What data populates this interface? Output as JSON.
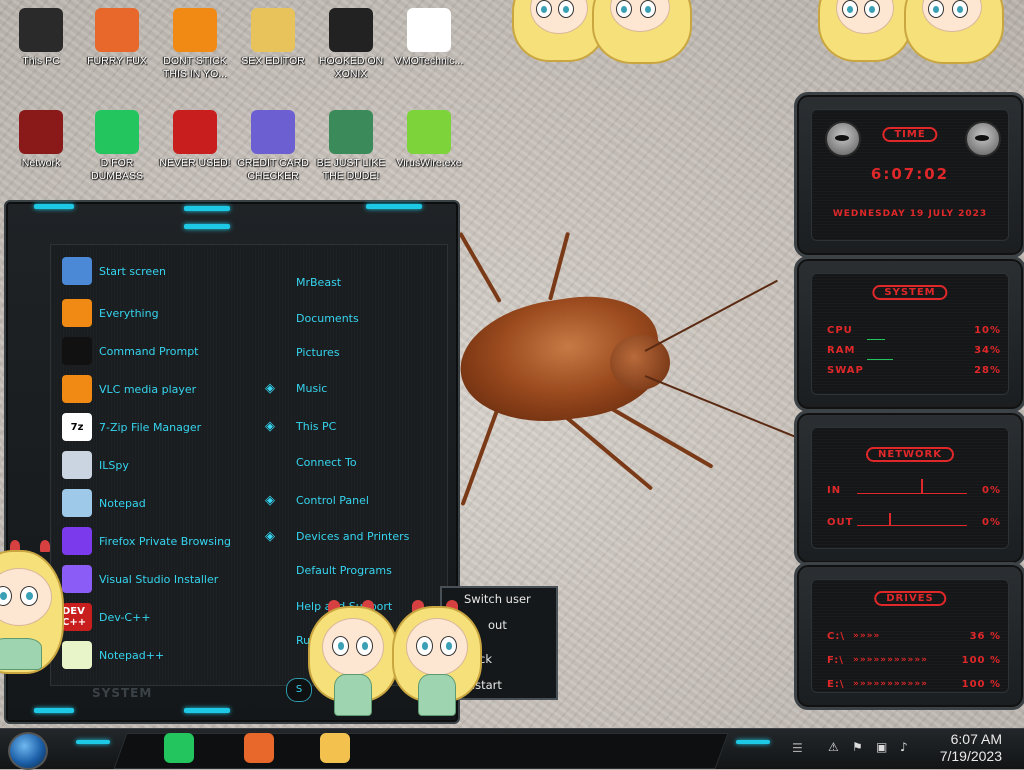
{
  "desktop": {
    "icons": [
      {
        "label": "This PC",
        "icon": "computer-icon",
        "color": "#2a2a2a"
      },
      {
        "label": "FURRY FUX",
        "icon": "firefox-icon",
        "color": "#e8672a"
      },
      {
        "label": "DONT STICK THIS IN YO...",
        "icon": "vlc-icon",
        "color": "#f08a14"
      },
      {
        "label": "SEX EDITOR",
        "icon": "hxd-icon",
        "color": "#e8c25a"
      },
      {
        "label": "HOOKED ON XONIX",
        "icon": "xonix-icon",
        "color": "#222222"
      },
      {
        "label": "VMOTechnic...",
        "icon": "doctor-icon",
        "color": "#ffffff"
      },
      {
        "label": "Network",
        "icon": "network-icon",
        "color": "#8a1a1a"
      },
      {
        "label": "D FOR DUMBASS",
        "icon": "spotify-icon",
        "color": "#22c55e"
      },
      {
        "label": "NEVER USED!",
        "icon": "devcpp-icon",
        "color": "#c81e1e"
      },
      {
        "label": "CREDIT CARD CHECKER",
        "icon": "credit-card-icon",
        "color": "#6b5fd1"
      },
      {
        "label": "BE JUST LIKE THE DUDE!",
        "icon": "elf-icon",
        "color": "#3a8a5a"
      },
      {
        "label": "VirusWire.exe",
        "icon": "lime-icon",
        "color": "#7dd43a"
      }
    ]
  },
  "start_menu": {
    "left_items": [
      {
        "label": "Start screen",
        "icon": "start-screen-icon"
      },
      {
        "label": "Everything",
        "icon": "magnifier-icon"
      },
      {
        "label": "Command Prompt",
        "icon": "cmd-icon"
      },
      {
        "label": "VLC media player",
        "icon": "vlc-icon"
      },
      {
        "label": "7-Zip File Manager",
        "icon": "7zip-icon",
        "glyph": "7z"
      },
      {
        "label": "ILSpy",
        "icon": "ilspy-icon"
      },
      {
        "label": "Notepad",
        "icon": "notepad-icon"
      },
      {
        "label": "Firefox Private Browsing",
        "icon": "firefox-private-icon"
      },
      {
        "label": "Visual Studio Installer",
        "icon": "visual-studio-icon"
      },
      {
        "label": "Dev-C++",
        "icon": "devcpp-icon",
        "glyph": "DEV C++"
      },
      {
        "label": "Notepad++",
        "icon": "notepadpp-icon"
      }
    ],
    "right_items": [
      {
        "label": "MrBeast",
        "arrow": false
      },
      {
        "label": "Documents",
        "arrow": false
      },
      {
        "label": "Pictures",
        "arrow": false
      },
      {
        "label": "Music",
        "arrow": true
      },
      {
        "label": "This PC",
        "arrow": true
      },
      {
        "label": "Connect To",
        "arrow": false
      },
      {
        "label": "Control Panel",
        "arrow": true
      },
      {
        "label": "Devices and Printers",
        "arrow": true
      },
      {
        "label": "Default Programs",
        "arrow": false
      },
      {
        "label": "Help and Support",
        "arrow": false
      },
      {
        "label": "Run",
        "arrow": false
      }
    ],
    "system_label": "SYSTEM",
    "power_glyph": "S",
    "accent": "#35d4ef"
  },
  "power_flyout": {
    "items": [
      "Switch user",
      "out",
      "ock",
      "estart"
    ]
  },
  "gadgets": {
    "time": {
      "title": "TIME",
      "clock": "6:07:02",
      "date": "WEDNESDAY 19 JULY 2023"
    },
    "system": {
      "title": "SYSTEM",
      "rows": [
        {
          "label": "CPU",
          "value": "10%"
        },
        {
          "label": "RAM",
          "value": "34%"
        },
        {
          "label": "SWAP",
          "value": "28%"
        }
      ]
    },
    "network": {
      "title": "NETWORK",
      "rows": [
        {
          "label": "IN",
          "value": "0%"
        },
        {
          "label": "OUT",
          "value": "0%"
        }
      ]
    },
    "drives": {
      "title": "DRIVES",
      "rows": [
        {
          "label": "C:\\",
          "value": "36 %"
        },
        {
          "label": "F:\\",
          "value": "100 %"
        },
        {
          "label": "E:\\",
          "value": "100 %"
        }
      ]
    },
    "accent": "#e0282a"
  },
  "taskbar": {
    "apps": [
      {
        "name": "spotify",
        "icon": "spotify-icon",
        "color": "#22c55e"
      },
      {
        "name": "firefox",
        "icon": "firefox-icon",
        "color": "#e8672a"
      },
      {
        "name": "file-explorer",
        "icon": "folder-icon",
        "color": "#f2c14e"
      }
    ],
    "tray_icons": [
      "notification-icon",
      "flag-icon",
      "network-icon",
      "volume-icon"
    ],
    "time": "6:07 AM",
    "date": "7/19/2023"
  }
}
